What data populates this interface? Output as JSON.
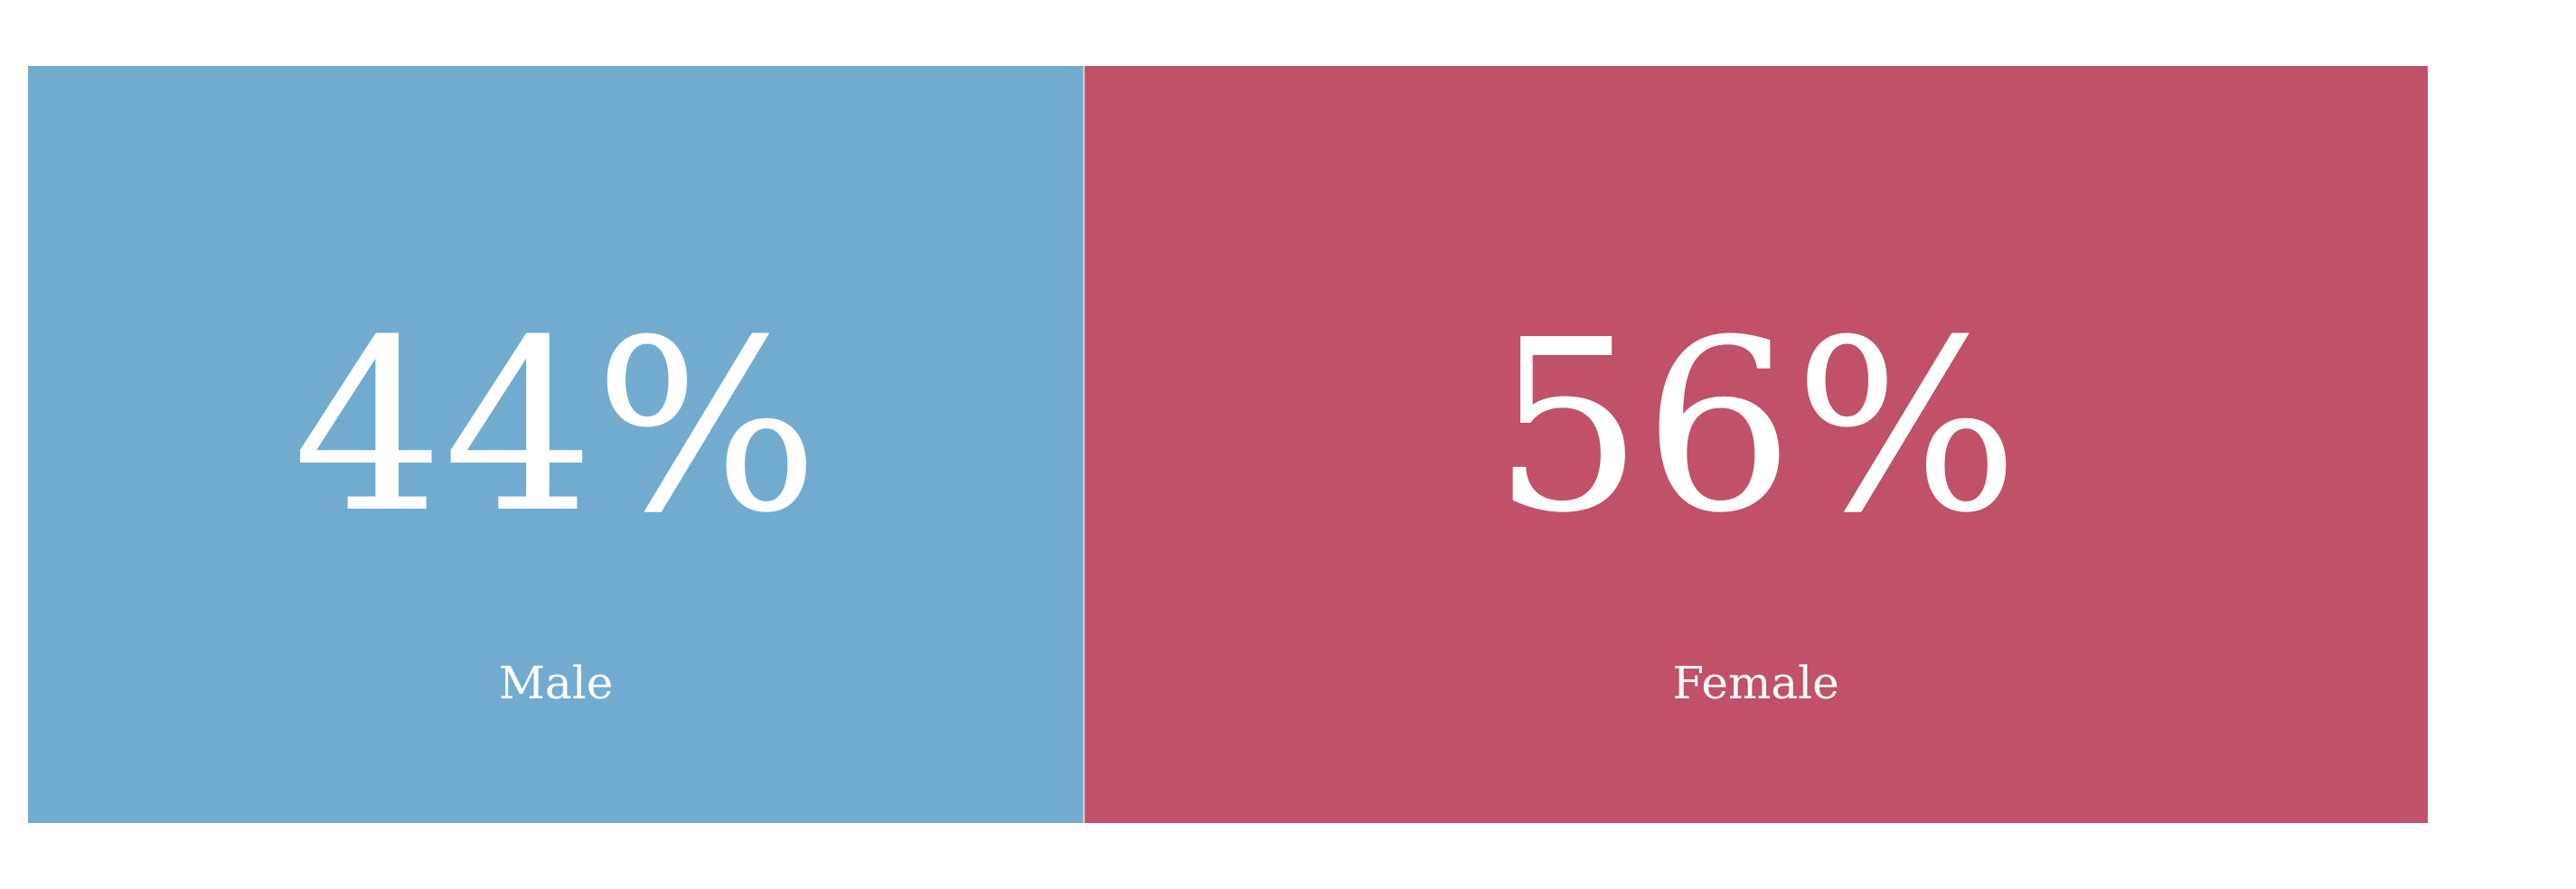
{
  "chart_data": {
    "type": "bar",
    "orientation": "horizontal-stacked",
    "categories": [
      "Male",
      "Female"
    ],
    "values": [
      44,
      56
    ],
    "value_labels": [
      "44%",
      "56%"
    ],
    "colors": [
      "#71acd0",
      "#c05168"
    ],
    "title": "",
    "xlabel": "",
    "ylabel": ""
  }
}
